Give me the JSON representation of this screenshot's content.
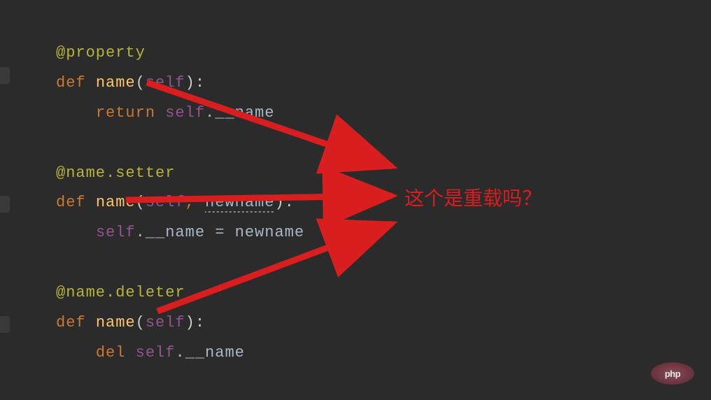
{
  "code": {
    "l1_decorator": "@property",
    "l2_def": "def",
    "l2_name": "name",
    "l2_p_open": "(",
    "l2_self": "self",
    "l2_p_close": ")",
    "l2_colon": ":",
    "l3_return": "return",
    "l3_self": "self",
    "l3_dot": ".",
    "l3_name": "__name",
    "l5_decorator": "@name.setter",
    "l6_def": "def",
    "l6_name": "name",
    "l6_p_open": "(",
    "l6_self": "self",
    "l6_comma": ",",
    "l6_param": "newname",
    "l6_p_close": ")",
    "l6_colon": ":",
    "l7_self": "self",
    "l7_dot": ".",
    "l7_lhs": "__name",
    "l7_eq": " = ",
    "l7_rhs": "newname",
    "l9_decorator": "@name.deleter",
    "l10_def": "def",
    "l10_name": "name",
    "l10_p_open": "(",
    "l10_self": "self",
    "l10_p_close": ")",
    "l10_colon": ":",
    "l11_del": "del",
    "l11_self": "self",
    "l11_dot": ".",
    "l11_name": "__name"
  },
  "annotation": {
    "text": "这个是重载吗？"
  },
  "watermark": {
    "text": "php"
  },
  "colors": {
    "arrow": "#d81e1e"
  }
}
